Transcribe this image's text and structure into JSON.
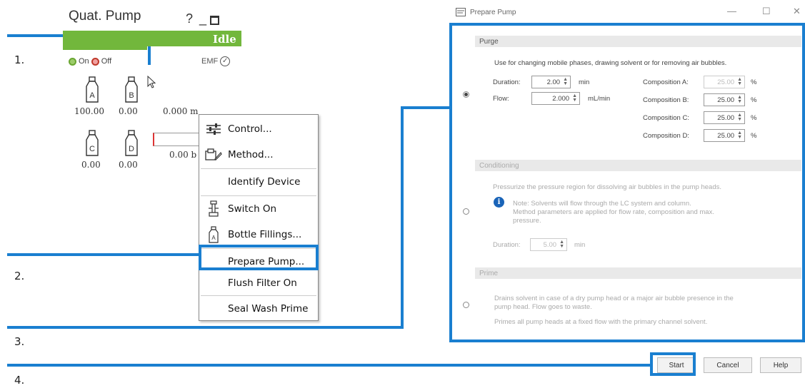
{
  "steps": [
    "1.",
    "2.",
    "3.",
    "4."
  ],
  "pump_widget": {
    "title": "Quat. Pump",
    "title_icons": "? _",
    "status": "Idle",
    "on_label": "On",
    "off_label": "Off",
    "emf_label": "EMF",
    "bottles": [
      {
        "label": "A",
        "value": "100.00"
      },
      {
        "label": "B",
        "value": "0.00"
      },
      {
        "label": "C",
        "value": "0.00"
      },
      {
        "label": "D",
        "value": "0.00"
      }
    ],
    "flow_value": "0.000 m",
    "pressure_value": "0.00 b"
  },
  "context_menu": {
    "items": [
      {
        "label": "Control...",
        "icon": "sliders-icon"
      },
      {
        "label": "Method...",
        "icon": "method-icon"
      },
      {
        "label": "Identify Device",
        "icon": ""
      },
      {
        "label": "Switch On",
        "icon": "pump-icon"
      },
      {
        "label": "Bottle Fillings...",
        "icon": "bottle-icon"
      },
      {
        "label": "Prepare Pump...",
        "icon": ""
      },
      {
        "label": "Flush Filter On",
        "icon": ""
      },
      {
        "label": "Seal Wash Prime",
        "icon": ""
      }
    ],
    "highlighted": "Prepare Pump..."
  },
  "dialog": {
    "title": "Prepare Pump",
    "window_controls": {
      "minimize": "—",
      "maximize": "☐",
      "close": "✕"
    },
    "purge": {
      "header": "Purge",
      "description": "Use for changing mobile phases, drawing solvent or for removing air bubbles.",
      "duration_label": "Duration:",
      "duration_value": "2.00",
      "duration_unit": "min",
      "flow_label": "Flow:",
      "flow_value": "2.000",
      "flow_unit": "mL/min",
      "compositions": [
        {
          "label": "Composition A:",
          "value": "25.00",
          "unit": "%"
        },
        {
          "label": "Composition B:",
          "value": "25.00",
          "unit": "%"
        },
        {
          "label": "Composition C:",
          "value": "25.00",
          "unit": "%"
        },
        {
          "label": "Composition D:",
          "value": "25.00",
          "unit": "%"
        }
      ]
    },
    "conditioning": {
      "header": "Conditioning",
      "description": "Pressurize the pressure region for dissolving air bubbles in the pump heads.",
      "note_line1": "Note: Solvents will flow through the LC system and column.",
      "note_line2": "Method parameters are applied for flow rate, composition and max.",
      "note_line3": "pressure.",
      "duration_label": "Duration:",
      "duration_value": "5.00",
      "duration_unit": "min"
    },
    "prime": {
      "header": "Prime",
      "line1": "Drains solvent in case of a dry pump head or a major air bubble presence in the",
      "line2": "pump head. Flow goes to waste.",
      "line3": "Primes all pump heads at a fixed flow with the primary channel solvent."
    },
    "buttons": {
      "start": "Start",
      "cancel": "Cancel",
      "help": "Help"
    }
  }
}
